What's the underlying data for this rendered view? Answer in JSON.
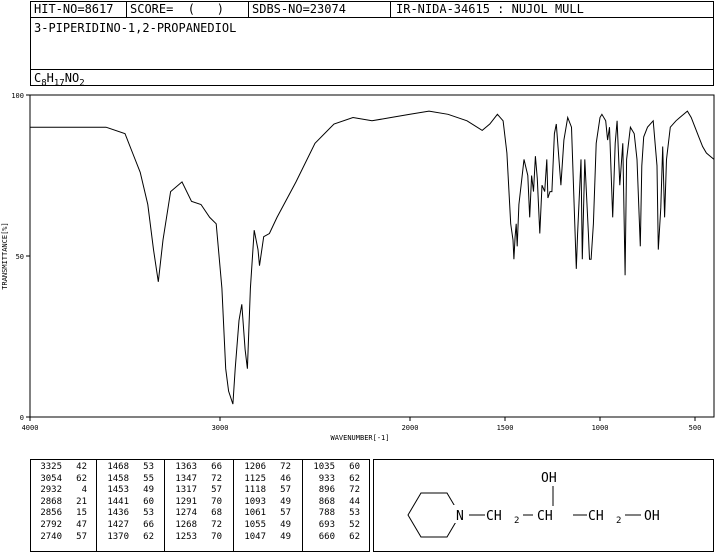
{
  "header": {
    "hit_no": "HIT-NO=8617",
    "score": "SCORE=  (   )",
    "sdbs_no": "SDBS-NO=23074",
    "ir_nida": "IR-NIDA-34615 : NUJOL MULL",
    "compound_name": "3-PIPERIDINO-1,2-PROPANEDIOL",
    "formula_main": [
      "C",
      "H",
      "NO"
    ],
    "formula_subs": [
      "8",
      "17",
      "2"
    ]
  },
  "chart_data": {
    "type": "line",
    "title": "",
    "xlabel": "WAVENUMBER[-1]",
    "ylabel": "TRANSMITTANCE[%]",
    "xlim": [
      4000,
      400
    ],
    "ylim": [
      0,
      100
    ],
    "x_ticks": [
      4000,
      3000,
      2000,
      1500,
      1000,
      500
    ],
    "y_ticks": [
      0,
      50,
      100
    ],
    "x_tick_labels": [
      "4000",
      "3000",
      "2000",
      "1500",
      "1000",
      "500"
    ],
    "y_tick_labels": [
      "0",
      "50",
      "100"
    ],
    "series": [
      {
        "name": "",
        "points": [
          [
            4000,
            90
          ],
          [
            3800,
            90
          ],
          [
            3600,
            90
          ],
          [
            3500,
            88
          ],
          [
            3460,
            82
          ],
          [
            3420,
            76
          ],
          [
            3380,
            66
          ],
          [
            3350,
            52
          ],
          [
            3325,
            42
          ],
          [
            3300,
            55
          ],
          [
            3260,
            70
          ],
          [
            3200,
            73
          ],
          [
            3150,
            67
          ],
          [
            3100,
            66
          ],
          [
            3054,
            62
          ],
          [
            3020,
            60
          ],
          [
            2990,
            40
          ],
          [
            2970,
            15
          ],
          [
            2955,
            8
          ],
          [
            2932,
            4
          ],
          [
            2920,
            15
          ],
          [
            2900,
            30
          ],
          [
            2885,
            35
          ],
          [
            2868,
            21
          ],
          [
            2856,
            15
          ],
          [
            2840,
            40
          ],
          [
            2820,
            58
          ],
          [
            2800,
            52
          ],
          [
            2792,
            47
          ],
          [
            2770,
            56
          ],
          [
            2740,
            57
          ],
          [
            2700,
            62
          ],
          [
            2600,
            73
          ],
          [
            2500,
            85
          ],
          [
            2400,
            91
          ],
          [
            2300,
            93
          ],
          [
            2200,
            92
          ],
          [
            2100,
            93
          ],
          [
            2000,
            94
          ],
          [
            1900,
            95
          ],
          [
            1800,
            94
          ],
          [
            1700,
            92
          ],
          [
            1620,
            89
          ],
          [
            1580,
            91
          ],
          [
            1540,
            94
          ],
          [
            1510,
            92
          ],
          [
            1490,
            82
          ],
          [
            1470,
            60
          ],
          [
            1458,
            55
          ],
          [
            1453,
            49
          ],
          [
            1447,
            56
          ],
          [
            1441,
            60
          ],
          [
            1436,
            53
          ],
          [
            1427,
            66
          ],
          [
            1415,
            72
          ],
          [
            1400,
            80
          ],
          [
            1380,
            75
          ],
          [
            1370,
            62
          ],
          [
            1360,
            75
          ],
          [
            1350,
            70
          ],
          [
            1340,
            81
          ],
          [
            1330,
            74
          ],
          [
            1317,
            57
          ],
          [
            1305,
            72
          ],
          [
            1291,
            70
          ],
          [
            1280,
            80
          ],
          [
            1274,
            68
          ],
          [
            1263,
            70
          ],
          [
            1253,
            70
          ],
          [
            1240,
            88
          ],
          [
            1230,
            91
          ],
          [
            1206,
            72
          ],
          [
            1190,
            86
          ],
          [
            1170,
            93
          ],
          [
            1150,
            90
          ],
          [
            1125,
            46
          ],
          [
            1118,
            57
          ],
          [
            1100,
            80
          ],
          [
            1093,
            49
          ],
          [
            1080,
            80
          ],
          [
            1061,
            57
          ],
          [
            1055,
            49
          ],
          [
            1047,
            49
          ],
          [
            1035,
            60
          ],
          [
            1020,
            85
          ],
          [
            1000,
            93
          ],
          [
            990,
            94
          ],
          [
            970,
            92
          ],
          [
            960,
            86
          ],
          [
            950,
            90
          ],
          [
            933,
            62
          ],
          [
            920,
            85
          ],
          [
            910,
            92
          ],
          [
            896,
            72
          ],
          [
            880,
            85
          ],
          [
            868,
            44
          ],
          [
            860,
            80
          ],
          [
            840,
            90
          ],
          [
            820,
            88
          ],
          [
            805,
            80
          ],
          [
            788,
            53
          ],
          [
            780,
            78
          ],
          [
            770,
            87
          ],
          [
            750,
            90
          ],
          [
            720,
            92
          ],
          [
            700,
            78
          ],
          [
            693,
            52
          ],
          [
            680,
            65
          ],
          [
            670,
            84
          ],
          [
            660,
            62
          ],
          [
            650,
            80
          ],
          [
            630,
            90
          ],
          [
            600,
            92
          ],
          [
            580,
            93
          ],
          [
            540,
            95
          ],
          [
            520,
            93
          ],
          [
            500,
            90
          ],
          [
            480,
            87
          ],
          [
            460,
            84
          ],
          [
            440,
            82
          ],
          [
            420,
            81
          ],
          [
            400,
            80
          ]
        ]
      }
    ]
  },
  "peak_columns": [
    [
      [
        "3325",
        "42"
      ],
      [
        "3054",
        "62"
      ],
      [
        "2932",
        "4"
      ],
      [
        "2868",
        "21"
      ],
      [
        "2856",
        "15"
      ],
      [
        "2792",
        "47"
      ],
      [
        "2740",
        "57"
      ]
    ],
    [
      [
        "1468",
        "53"
      ],
      [
        "1458",
        "55"
      ],
      [
        "1453",
        "49"
      ],
      [
        "1441",
        "60"
      ],
      [
        "1436",
        "53"
      ],
      [
        "1427",
        "66"
      ],
      [
        "1370",
        "62"
      ]
    ],
    [
      [
        "1363",
        "66"
      ],
      [
        "1347",
        "72"
      ],
      [
        "1317",
        "57"
      ],
      [
        "1291",
        "70"
      ],
      [
        "1274",
        "68"
      ],
      [
        "1268",
        "72"
      ],
      [
        "1253",
        "70"
      ]
    ],
    [
      [
        "1206",
        "72"
      ],
      [
        "1125",
        "46"
      ],
      [
        "1118",
        "57"
      ],
      [
        "1093",
        "49"
      ],
      [
        "1061",
        "57"
      ],
      [
        "1055",
        "49"
      ],
      [
        "1047",
        "49"
      ]
    ],
    [
      [
        "1035",
        "60"
      ],
      [
        "933",
        "62"
      ],
      [
        "896",
        "72"
      ],
      [
        "868",
        "44"
      ],
      [
        "788",
        "53"
      ],
      [
        "693",
        "52"
      ],
      [
        "660",
        "62"
      ]
    ]
  ],
  "structure": {
    "labels": {
      "oh_top": "OH",
      "n": "N",
      "ch2_left": "CH",
      "ch": "CH",
      "ch2_right": "CH",
      "oh_right": "OH",
      "sub2": "2"
    }
  }
}
